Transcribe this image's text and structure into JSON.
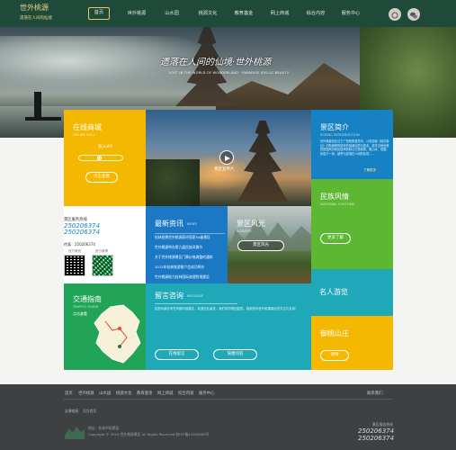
{
  "brand": {
    "logo_line1": "世外桃源",
    "logo_line2": "遗落在人间的仙境"
  },
  "nav": {
    "items": [
      "首页",
      "世外桃源",
      "山水园",
      "桃源文化",
      "教育基金",
      "网上商城",
      "综合内容",
      "服务中心"
    ]
  },
  "hero": {
    "slogan": "遗落在人间的仙境·世外桃源",
    "slogan_en": "LOST IN THE WORLD OF WONDERLAND · PARADISE IDYLLIC BEAUTY"
  },
  "online": {
    "title": "在线商城",
    "subtitle": "ONLINE MALL",
    "vip": "加入VIP",
    "qty": "0",
    "button": "点击查看"
  },
  "video": {
    "caption": "景区宣传片"
  },
  "intro": {
    "title": "景区简介",
    "subtitle": "SCENIC INTRODUCTION",
    "text": "世外桃源景区位于广西阳朔县境内，以电影版《桃花源记》中陶渊明所描写的桃源仙境为蓝本，依托当地优美的田园风光和民族风情精心打造而成，集山水、田园、民俗于一体，被誉为遗落在人间的仙境……",
    "more": "了解更多"
  },
  "info": {
    "hotline_label": "景区服务热线",
    "phone1": "250206374",
    "phone2": "250206374",
    "fax": "传真：250206374",
    "qr1": "官方微信",
    "qr2": "官方微博"
  },
  "news": {
    "title": "最新资讯",
    "subtitle": "NEWS",
    "items": [
      "桂林阳朔世外桃源获评国家5A级景区",
      "世外桃源举办第九届民族风情节",
      "关于世外桃源景区门票价格调整的通知",
      "2015年桂林旅游推介会成功举办",
      "世外桃源助力桂林国际旅游胜地建设"
    ]
  },
  "scenery": {
    "title": "景区风光",
    "subtitle": "SCENERY",
    "button": "景区风光"
  },
  "ethnic": {
    "title": "民族风情",
    "subtitle": "NATIONAL CUSTOMS",
    "button": "更多了解"
  },
  "traffic": {
    "title": "交通指南",
    "subtitle": "TRAFFIC GUIDE",
    "link": "点击查看"
  },
  "message": {
    "title": "留言咨询",
    "subtitle": "MESSAGE",
    "text": "如您对景区有任何疑问或建议，欢迎在此留言，我们将尽快回复您。感谢您对世外桃源景区的关注与支持！",
    "btn1": "在线留言",
    "btn2": "快捷问答"
  },
  "famous": {
    "title": "名人游览"
  },
  "villa": {
    "title": "御桃山庄",
    "button": "详情"
  },
  "footer": {
    "links": [
      "首页",
      "世外桃源",
      "山水园",
      "桃源文化",
      "教育基金",
      "网上商城",
      "综合内容",
      "服务中心"
    ],
    "right": "联系我们",
    "row2": [
      "友情链接",
      "设为首页"
    ],
    "copyright": "Copyright © 2015 世外桃源景区 All Rights Reserved 桂ICP备12000000号",
    "address": "地址：桂林市阳朔县",
    "hotline_label": "景区服务热线",
    "phone1": "250206374",
    "phone2": "250206374"
  },
  "colors": {
    "yellow": "#f5b800",
    "blue": "#1682c4",
    "green": "#5db733",
    "teal": "#1fa9b8",
    "darkgreen": "#21a457",
    "nav": "#1f4a3a"
  }
}
